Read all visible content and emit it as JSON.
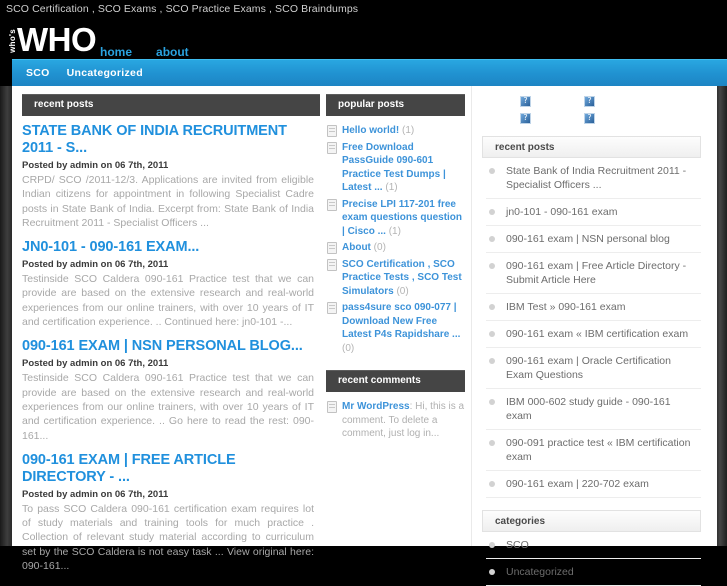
{
  "topbar": {
    "tagline": "SCO Certification , SCO Exams , SCO Practice Exams , SCO Braindumps"
  },
  "masthead": {
    "logo_small": "who's",
    "logo_big": "WHO",
    "nav": [
      {
        "label": "home"
      },
      {
        "label": "about"
      }
    ]
  },
  "categorybar": {
    "items": [
      {
        "label": "SCO"
      },
      {
        "label": "Uncategorized"
      }
    ]
  },
  "posts_column": {
    "header": "recent posts",
    "posts": [
      {
        "title": "STATE BANK OF INDIA RECRUITMENT 2011 - S...",
        "meta": "Posted by admin on 06 7th, 2011",
        "excerpt": "CRPD/ SCO /2011-12/3. Applications are invited from eligible Indian citizens for appointment in following Specialist Cadre posts in State Bank of India. Excerpt from:   State Bank of India Recruitment 2011 - Specialist Officers ..."
      },
      {
        "title": "JN0-101 - 090-161 EXAM...",
        "meta": "Posted by admin on 06 7th, 2011",
        "excerpt": "Testinside SCO Caldera 090-161 Practice test that we can provide are based on the extensive research and real-world experiences from our online trainers, with over 10 years of IT and certification experience. .. Continued here:  jn0-101 -..."
      },
      {
        "title": "090-161 EXAM | NSN PERSONAL BLOG...",
        "meta": "Posted by admin on 06 7th, 2011",
        "excerpt": "Testinside SCO Caldera 090-161 Practice test that we can provide are based on the extensive research and real-world experiences from our online trainers, with over 10 years of IT and certification experience. .. Go here to read the rest:  090-161..."
      },
      {
        "title": "090-161 EXAM | FREE ARTICLE DIRECTORY - ...",
        "meta": "Posted by admin on 06 7th, 2011",
        "excerpt": "To pass SCO Caldera 090-161 certification exam requires lot of study materials and training tools for much practice . Collection of relevant study material according to curriculum set by the SCO Caldera is not easy task ... View original here: 090-161..."
      }
    ]
  },
  "middle_column": {
    "popular_header": "popular posts",
    "popular_posts": [
      {
        "icon": "document-icon",
        "label": "Hello world!",
        "count": "(1)"
      },
      {
        "icon": "document-icon",
        "label": "Free Download PassGuide 090-601 Practice Test Dumps | Latest ...",
        "count": "(1)"
      },
      {
        "icon": "document-icon",
        "label": "Precise LPI 117-201 free exam questions question | Cisco ...",
        "count": "(1)"
      },
      {
        "icon": "document-icon",
        "label": "About",
        "count": "(0)"
      },
      {
        "icon": "document-icon",
        "label": "SCO Certification , SCO Practice Tests , SCO Test Simulators",
        "count": "(0)"
      },
      {
        "icon": "document-icon",
        "label": "pass4sure sco 090-077 | Download New Free Latest P4s Rapidshare ...",
        "count": "(0)"
      }
    ],
    "comments_header": "recent comments",
    "comments": [
      {
        "icon": "document-icon",
        "author": "Mr WordPress",
        "text": ": Hi, this is a comment. To delete a comment, just log in..."
      }
    ]
  },
  "sidebar": {
    "thumbnails": [
      {
        "name": "broken-image-1",
        "alt": "?"
      },
      {
        "name": "broken-image-2",
        "alt": "?"
      },
      {
        "name": "broken-image-3",
        "alt": "?"
      },
      {
        "name": "broken-image-4",
        "alt": "?"
      }
    ],
    "recent_posts_header": "recent posts",
    "recent_posts": [
      {
        "label": "State Bank of India Recruitment 2011 - Specialist Officers ..."
      },
      {
        "label": "jn0-101 - 090-161 exam"
      },
      {
        "label": "090-161 exam | NSN personal blog"
      },
      {
        "label": "090-161 exam | Free Article Directory - Submit Article Here"
      },
      {
        "label": "IBM Test » 090-161 exam"
      },
      {
        "label": "090-161 exam « IBM certification exam"
      },
      {
        "label": "090-161 exam | Oracle Certification Exam Questions"
      },
      {
        "label": "IBM 000-602 study guide - 090-161 exam"
      },
      {
        "label": "090-091 practice test « IBM certification exam"
      },
      {
        "label": "090-161 exam | 220-702 exam"
      }
    ],
    "categories_header": "categories",
    "categories": [
      {
        "label": "SCO"
      },
      {
        "label": "Uncategorized"
      }
    ]
  },
  "colors": {
    "accent_blue": "#2090dd",
    "nav_blue": "#29a7e1",
    "dark_panel": "#454545",
    "body_black": "#000000"
  }
}
